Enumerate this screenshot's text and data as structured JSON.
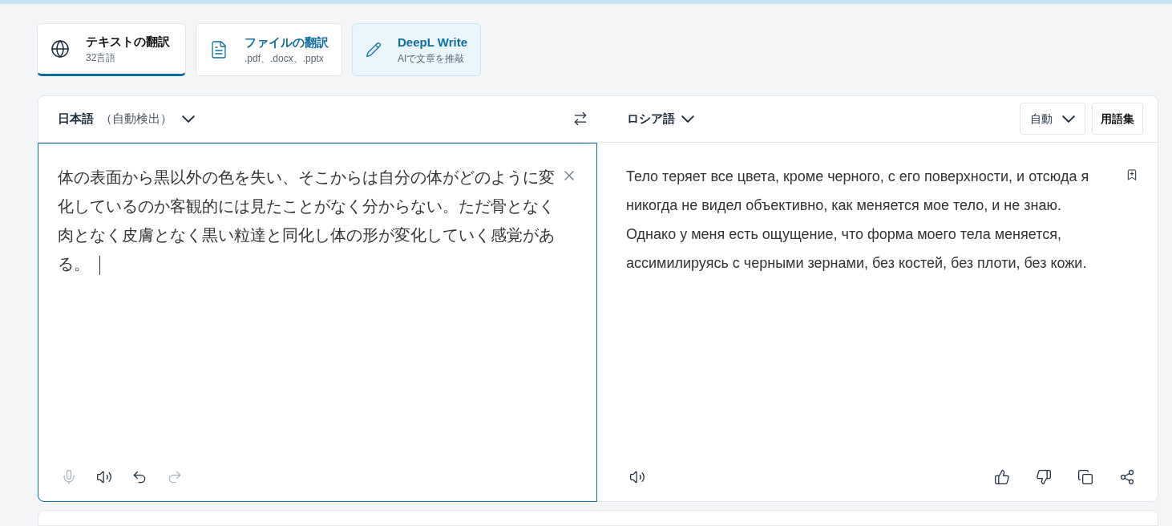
{
  "tabs": [
    {
      "kind": "text",
      "title": "テキストの翻訳",
      "subtitle": "32言語",
      "selected": true
    },
    {
      "kind": "file",
      "title": "ファイルの翻訳",
      "subtitle": ".pdf、.docx、.pptx",
      "selected": false
    },
    {
      "kind": "write",
      "title": "DeepL Write",
      "subtitle": "AIで文章を推敲",
      "selected": false
    }
  ],
  "source": {
    "language": "日本語",
    "detect_note": "（自動検出）",
    "text": "体の表面から黒以外の色を失い、そこからは自分の体がどのように変化しているのか客観的には見たことがなく分からない。ただ骨となく肉となく皮膚となく黒い粒達と同化し体の形が変化していく感覚がある。",
    "tools": [
      {
        "kind": "mic",
        "disabled": true
      },
      {
        "kind": "speaker",
        "disabled": false
      },
      {
        "kind": "undo",
        "disabled": false
      },
      {
        "kind": "redo",
        "disabled": true
      }
    ]
  },
  "target": {
    "language": "ロシア語",
    "formality": "自動",
    "glossary": "用語集",
    "text": "Тело теряет все цвета, кроме черного, с его поверхности, и отсюда я никогда не видел объективно, как меняется мое тело, и не знаю. Однако у меня есть ощущение, что форма моего тела меняется, ассимилируясь с черными зернами, без костей, без плоти, без кожи."
  }
}
